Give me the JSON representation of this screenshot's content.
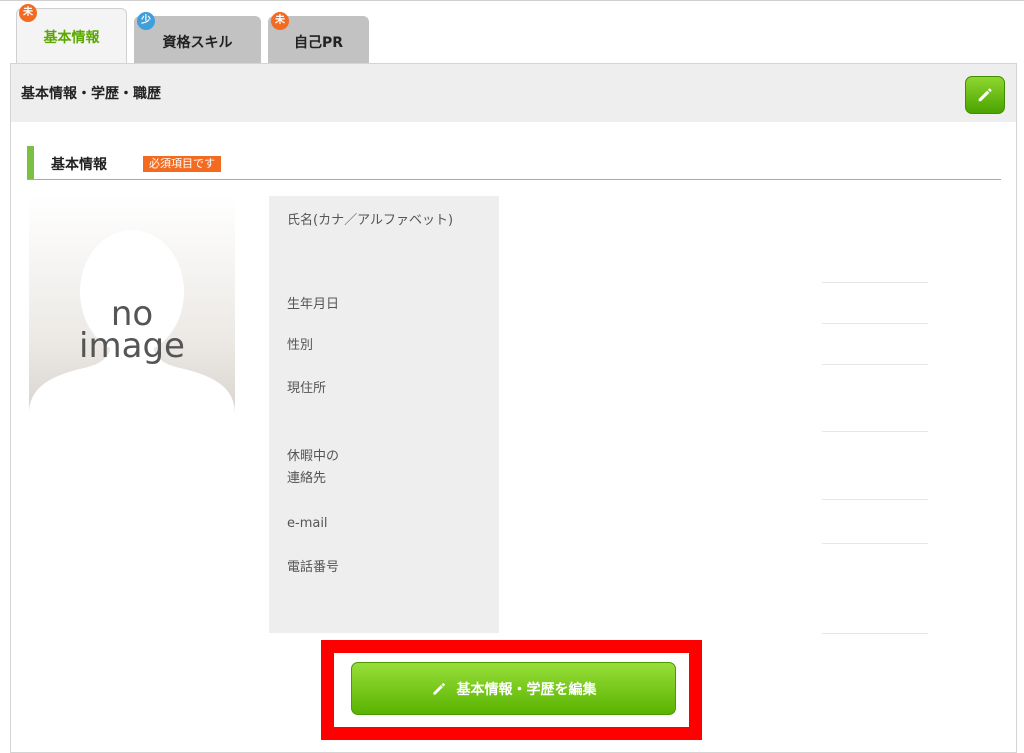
{
  "tabs": [
    {
      "label": "基本情報",
      "badge": "未",
      "active": true
    },
    {
      "label": "資格スキル",
      "badge": "少",
      "active": false
    },
    {
      "label": "自己PR",
      "badge": "未",
      "active": false
    }
  ],
  "card": {
    "title": "基本情報・学歴・職歴"
  },
  "section": {
    "title": "基本情報",
    "required_badge": "必須項目です"
  },
  "photo": {
    "text_line1": "no",
    "text_line2": "image"
  },
  "fields": [
    {
      "label": "氏名(カナ／アルファベット)"
    },
    {
      "label": "生年月日"
    },
    {
      "label": "性別"
    },
    {
      "label": "現住所"
    },
    {
      "label_line1": "休暇中の",
      "label_line2": "連絡先"
    },
    {
      "label": "e-mail"
    },
    {
      "label": "電話番号"
    }
  ],
  "edit_button": {
    "label": "基本情報・学歴を編集"
  },
  "colors": {
    "accent_green": "#7ac143",
    "badge_orange": "#f26b21",
    "badge_blue": "#3e9fdb",
    "highlight_red": "#ff0000"
  },
  "icons": {
    "edit": "pencil-icon"
  }
}
